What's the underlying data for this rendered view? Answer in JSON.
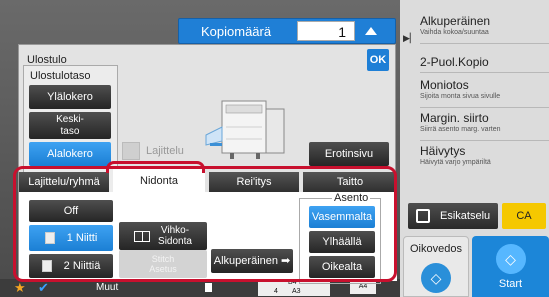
{
  "copies": {
    "label": "Kopiomäärä",
    "value": "1"
  },
  "dialog": {
    "title": "Ulostulo",
    "ok": "OK",
    "output_tray": {
      "label": "Ulostulotaso",
      "options": [
        "Ylälokero",
        "Keski-\ntaso",
        "Alalokero"
      ],
      "selected": "Alalokero"
    },
    "sort_checkbox": "Lajittelu",
    "separator_button": "Erotinsivu",
    "tabs": [
      "Lajittelu/ryhmä",
      "Nidonta",
      "Rei'itys",
      "Taitto"
    ],
    "active_tab": "Nidonta",
    "staple": {
      "off": "Off",
      "one": "1 Niitti",
      "two": "2 Niittiä",
      "booklet": "Vihko-\nSidonta",
      "disabled": "Stitch\nAsetus",
      "original": "Alkuperäinen"
    },
    "position": {
      "label": "Asento",
      "options": [
        "Vasemmalta",
        "Ylhäällä",
        "Oikealta"
      ],
      "selected": "Vasemmalta"
    }
  },
  "right_panel": {
    "items": [
      {
        "title": "Alkuperäinen",
        "sub": "Vaihda kokoa/suuntaa"
      },
      {
        "title": "2-Puol.Kopio",
        "sub": ""
      },
      {
        "title": "Moniotos",
        "sub": "Sijoita monta sivua sivulle"
      },
      {
        "title": "Margin. siirto",
        "sub": "Siirrä asento marg. varten"
      },
      {
        "title": "Häivytys",
        "sub": "Häivytä varjo ympäriltä"
      }
    ],
    "preview": "Esikatselu",
    "ca": "CA",
    "oikovedos": "Oikovedos",
    "start": "Start"
  },
  "bottom": {
    "muut": "Muut",
    "tray_top": "B4",
    "tray_left": "4",
    "tray_right": "A3",
    "paper": "A4"
  },
  "colors": {
    "accent": "#1e7fd6",
    "highlight": "#c8102e",
    "ca": "#f5c800"
  }
}
